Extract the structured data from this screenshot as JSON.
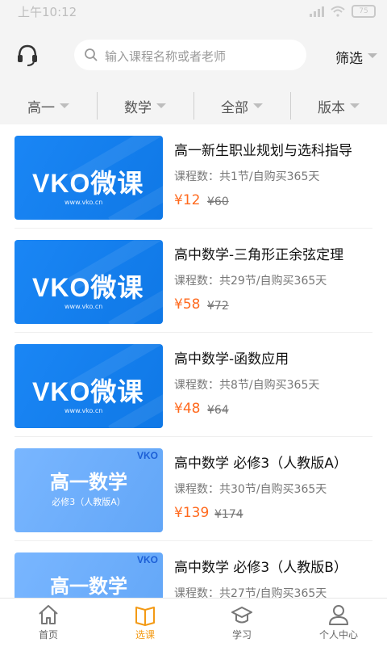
{
  "status_bar": {
    "time": "上午10:12",
    "battery": "75"
  },
  "header": {
    "icon": "headset-icon",
    "search_placeholder": "输入课程名称或者老师",
    "filter_label": "筛选"
  },
  "category_tabs": [
    {
      "label": "高一"
    },
    {
      "label": "数学"
    },
    {
      "label": "全部"
    },
    {
      "label": "版本"
    }
  ],
  "courses": [
    {
      "title": "高一新生职业规划与选科指导",
      "meta": "课程数：共1节/自购买365天",
      "price": "¥12",
      "original_price": "¥60",
      "thumb": {
        "style": "vko",
        "brand": "VKO微课",
        "site": "www.vko.cn"
      }
    },
    {
      "title": "高中数学-三角形正余弦定理",
      "meta": "课程数：共29节/自购买365天",
      "price": "¥58",
      "original_price": "¥72",
      "thumb": {
        "style": "vko",
        "brand": "VKO微课",
        "site": "www.vko.cn"
      }
    },
    {
      "title": "高中数学-函数应用",
      "meta": "课程数：共8节/自购买365天",
      "price": "¥48",
      "original_price": "¥64",
      "thumb": {
        "style": "vko",
        "brand": "VKO微课",
        "site": "www.vko.cn"
      }
    },
    {
      "title": "高中数学 必修3（人教版A）",
      "meta": "课程数：共30节/自购买365天",
      "price": "¥139",
      "original_price": "¥174",
      "thumb": {
        "style": "math",
        "big": "高一数学",
        "small": "必修3（人教版A）",
        "corner": "VKO"
      }
    },
    {
      "title": "高中数学 必修3（人教版B）",
      "meta": "课程数：共27节/自购买365天",
      "price": "",
      "original_price": "",
      "thumb": {
        "style": "math",
        "big": "高一数学",
        "small": "",
        "corner": "VKO"
      }
    }
  ],
  "bottom_nav": [
    {
      "label": "首页",
      "icon": "home-icon",
      "active": false
    },
    {
      "label": "选课",
      "icon": "book-icon",
      "active": true
    },
    {
      "label": "学习",
      "icon": "graduation-cap-icon",
      "active": false
    },
    {
      "label": "个人中心",
      "icon": "user-icon",
      "active": false
    }
  ],
  "colors": {
    "accent": "#f39a15",
    "price": "#ff6a1e",
    "thumb_blue": "#1a86f5",
    "thumb_light": "#79b6ff"
  }
}
